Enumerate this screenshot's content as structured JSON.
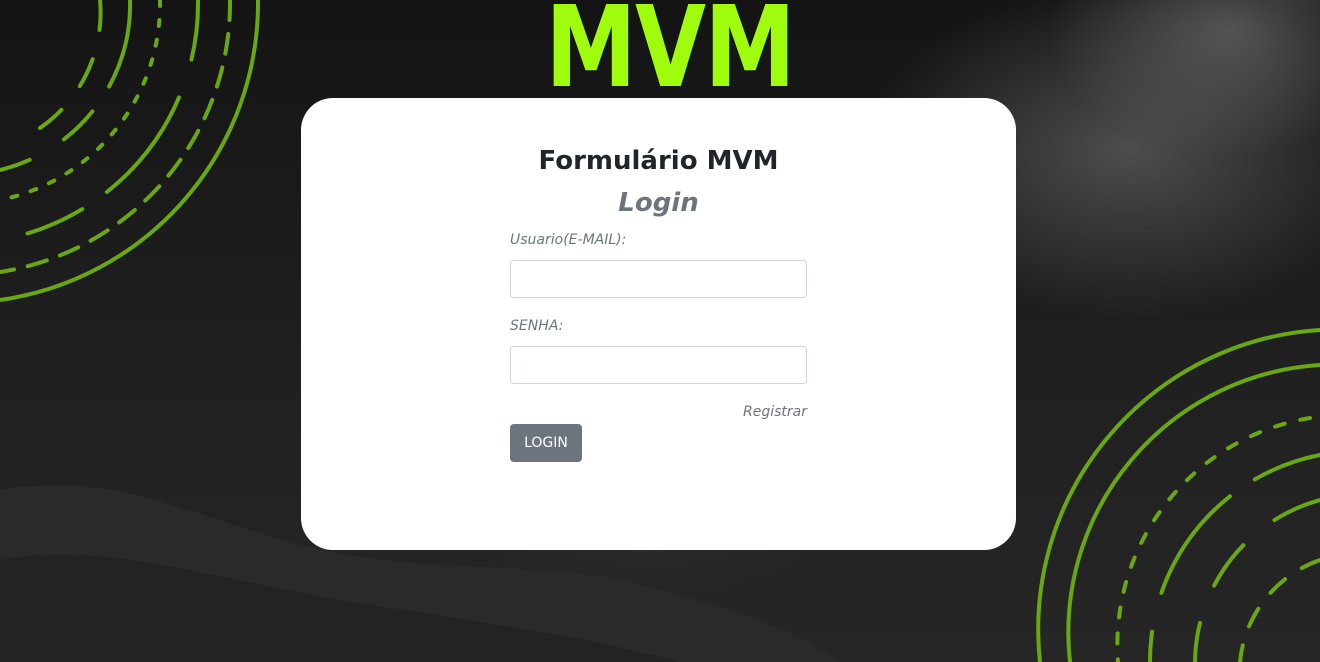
{
  "brand": {
    "logo_text": "MVM",
    "accent_color": "#9efc0c"
  },
  "form": {
    "title": "Formulário MVM",
    "subtitle": "Login",
    "email_label": "Usuario(E-MAIL):",
    "email_value": "",
    "password_label": "SENHA:",
    "password_value": "",
    "register_link": "Registrar",
    "login_button": "LOGIN"
  },
  "colors": {
    "background": "#1a1a1a",
    "card": "#ffffff",
    "button": "#6c757d",
    "text_muted": "#6c757d",
    "text_dark": "#212529"
  }
}
